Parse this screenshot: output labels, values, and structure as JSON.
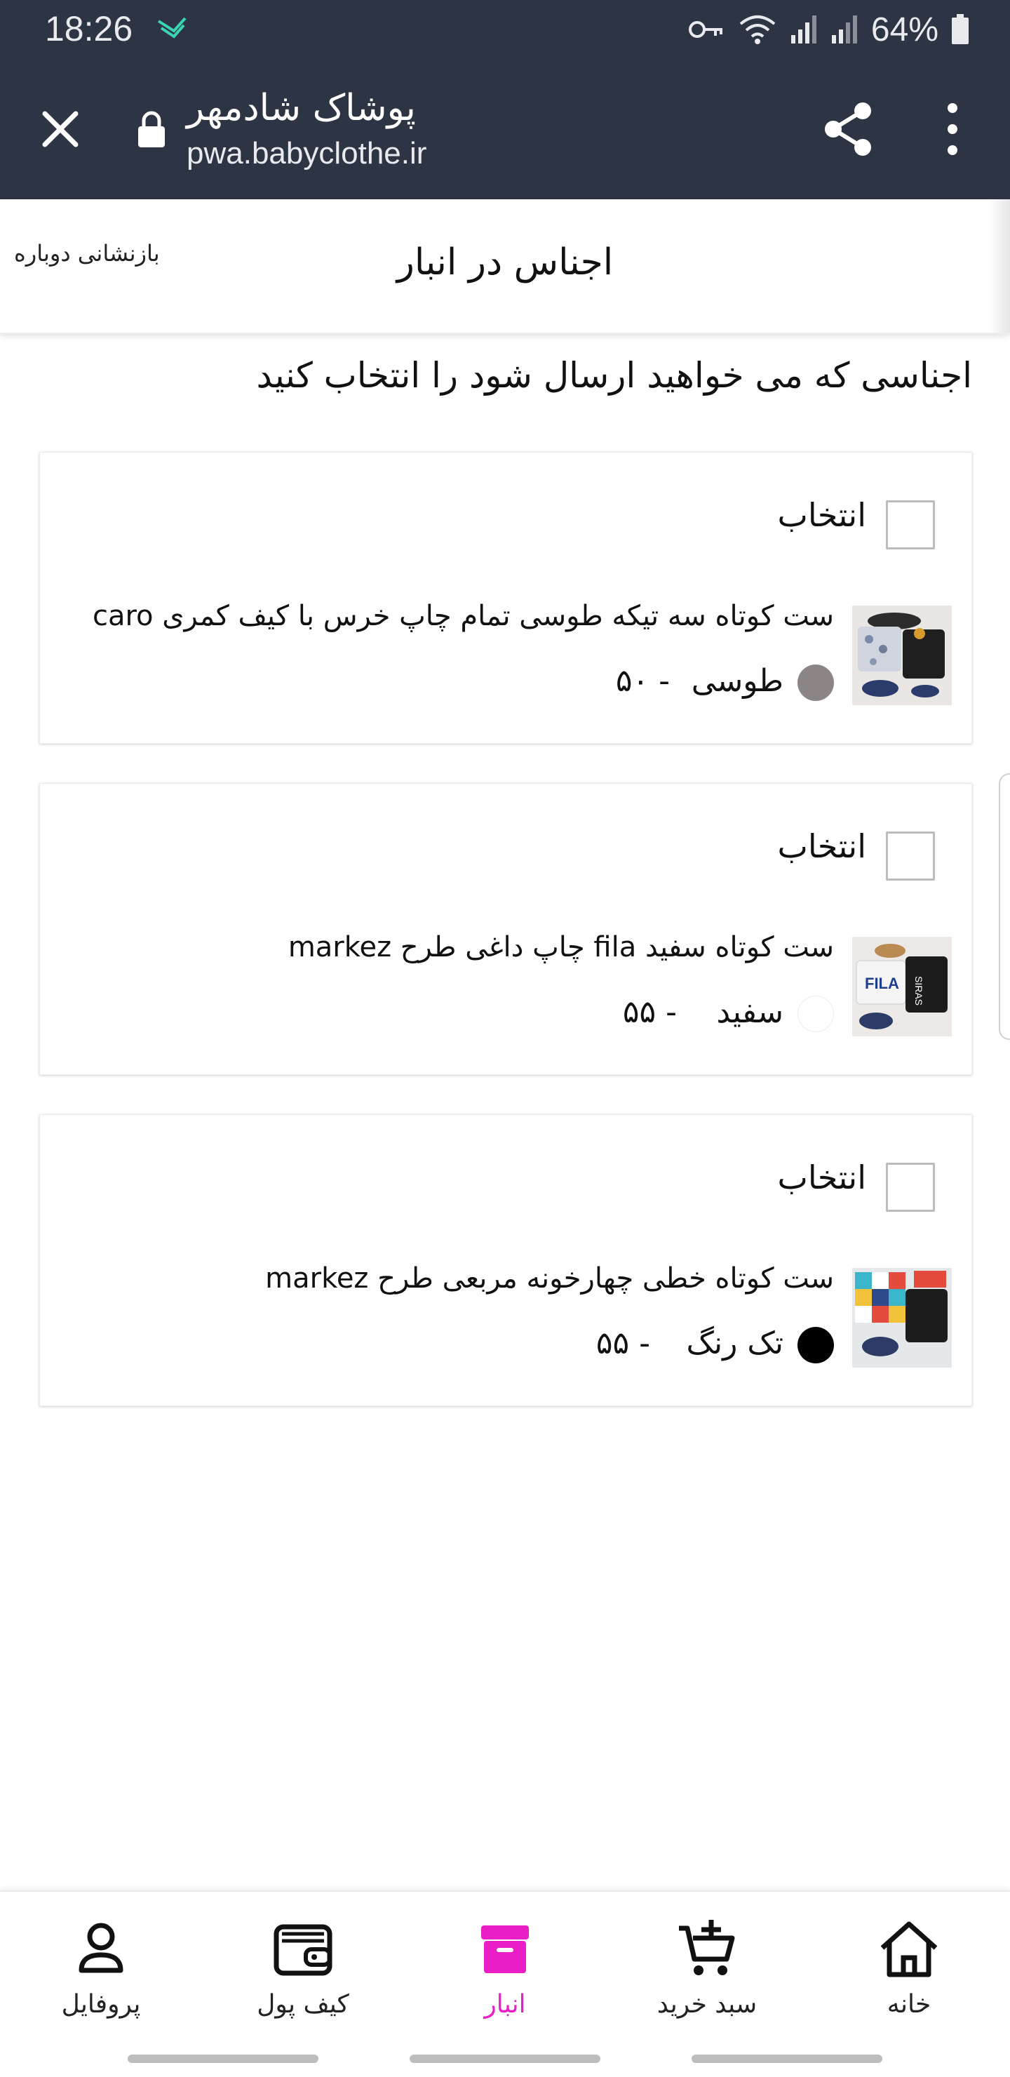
{
  "status_bar": {
    "time": "18:26",
    "battery": "64%",
    "icons": [
      "app-notification-icon",
      "vpn-key-icon",
      "wifi-icon",
      "signal-icon",
      "signal-icon",
      "battery-icon"
    ]
  },
  "toolbar": {
    "title": "پوشاک شادمهر",
    "url": "pwa.babyclothe.ir",
    "close_icon": "close-icon",
    "lock_icon": "lock-icon",
    "share_icon": "share-icon",
    "menu_icon": "more-vert-icon"
  },
  "header": {
    "title": "اجناس در انبار",
    "reset_label": "بازنشانی دوباره"
  },
  "instruction": "اجناسی که می خواهید ارسال شود را انتخاب کنید",
  "products": [
    {
      "select_label": "انتخاب",
      "checked": false,
      "name": "ست کوتاه سه تیکه طوسی تمام چاپ خرس با کیف کمری caro",
      "color_name": "طوسی",
      "color_hex": "#8c8586",
      "size": "۵۰  -"
    },
    {
      "select_label": "انتخاب",
      "checked": false,
      "name": "ست کوتاه سفید fila چاپ داغی طرح markez",
      "color_name": "سفید",
      "color_hex": "#ffffff",
      "size": "۵۵  -"
    },
    {
      "select_label": "انتخاب",
      "checked": false,
      "name": "ست کوتاه خطی چهارخونه مربعی طرح markez",
      "color_name": "تک رنگ",
      "color_hex": "#000000",
      "size": "۵۵  -"
    }
  ],
  "bottom_nav": {
    "active": "انبار",
    "active_color": "#e91ec4",
    "items": [
      {
        "label": "پروفایل",
        "icon": "profile-icon"
      },
      {
        "label": "کیف پول",
        "icon": "wallet-icon"
      },
      {
        "label": "انبار",
        "icon": "inventory-icon"
      },
      {
        "label": "سبد خرید",
        "icon": "cart-icon"
      },
      {
        "label": "خانه",
        "icon": "home-icon"
      }
    ]
  },
  "colors": {
    "toolbar_bg": "#2d3444",
    "accent": "#e91ec4"
  }
}
